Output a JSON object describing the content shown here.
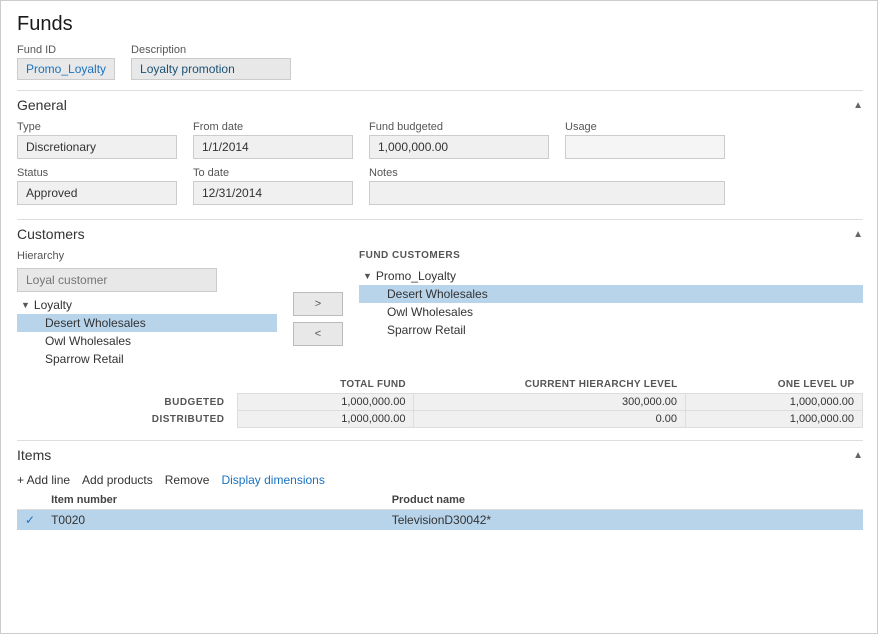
{
  "page": {
    "title": "Funds"
  },
  "fund_header": {
    "fund_id_label": "Fund ID",
    "fund_id_value": "Promo_Loyalty",
    "description_label": "Description",
    "description_value": "Loyalty promotion"
  },
  "general": {
    "section_title": "General",
    "type_label": "Type",
    "type_value": "Discretionary",
    "from_date_label": "From date",
    "from_date_value": "1/1/2014",
    "fund_budgeted_label": "Fund budgeted",
    "fund_budgeted_value": "1,000,000.00",
    "usage_label": "Usage",
    "usage_value": "",
    "status_label": "Status",
    "status_value": "Approved",
    "to_date_label": "To date",
    "to_date_value": "12/31/2014",
    "notes_label": "Notes",
    "notes_value": ""
  },
  "customers": {
    "section_title": "Customers",
    "hierarchy_label": "Hierarchy",
    "hierarchy_value": "Loyal customer",
    "arrow_right": ">",
    "arrow_left": "<",
    "fund_customers_label": "FUND CUSTOMERS",
    "left_tree": [
      {
        "id": "loyalty",
        "label": "Loyalty",
        "type": "parent",
        "indent": 1
      },
      {
        "id": "desert",
        "label": "Desert Wholesales",
        "type": "item",
        "indent": 2,
        "selected": true
      },
      {
        "id": "owl",
        "label": "Owl Wholesales",
        "type": "item",
        "indent": 2,
        "selected": false
      },
      {
        "id": "sparrow",
        "label": "Sparrow Retail",
        "type": "item",
        "indent": 2,
        "selected": false
      }
    ],
    "right_tree_root": "Promo_Loyalty",
    "right_tree": [
      {
        "id": "desert_r",
        "label": "Desert Wholesales",
        "type": "item",
        "indent": 2,
        "selected": true
      },
      {
        "id": "owl_r",
        "label": "Owl Wholesales",
        "type": "item",
        "indent": 2,
        "selected": false
      },
      {
        "id": "sparrow_r",
        "label": "Sparrow Retail",
        "type": "item",
        "indent": 2,
        "selected": false
      }
    ],
    "summary_headers": [
      "TOTAL FUND",
      "CURRENT HIERARCHY LEVEL",
      "ONE LEVEL UP"
    ],
    "budgeted_label": "BUDGETED",
    "distributed_label": "DISTRIBUTED",
    "budgeted_values": [
      "1,000,000.00",
      "300,000.00",
      "1,000,000.00"
    ],
    "distributed_values": [
      "1,000,000.00",
      "0.00",
      "1,000,000.00"
    ]
  },
  "items": {
    "section_title": "Items",
    "add_line_label": "+ Add line",
    "add_products_label": "Add products",
    "remove_label": "Remove",
    "display_dimensions_label": "Display dimensions",
    "columns": [
      {
        "id": "check",
        "label": ""
      },
      {
        "id": "item_number",
        "label": "Item number"
      },
      {
        "id": "product_name",
        "label": "Product name"
      }
    ],
    "rows": [
      {
        "check": true,
        "item_number": "T0020",
        "product_name": "TelevisionD30042*",
        "selected": true
      }
    ]
  }
}
